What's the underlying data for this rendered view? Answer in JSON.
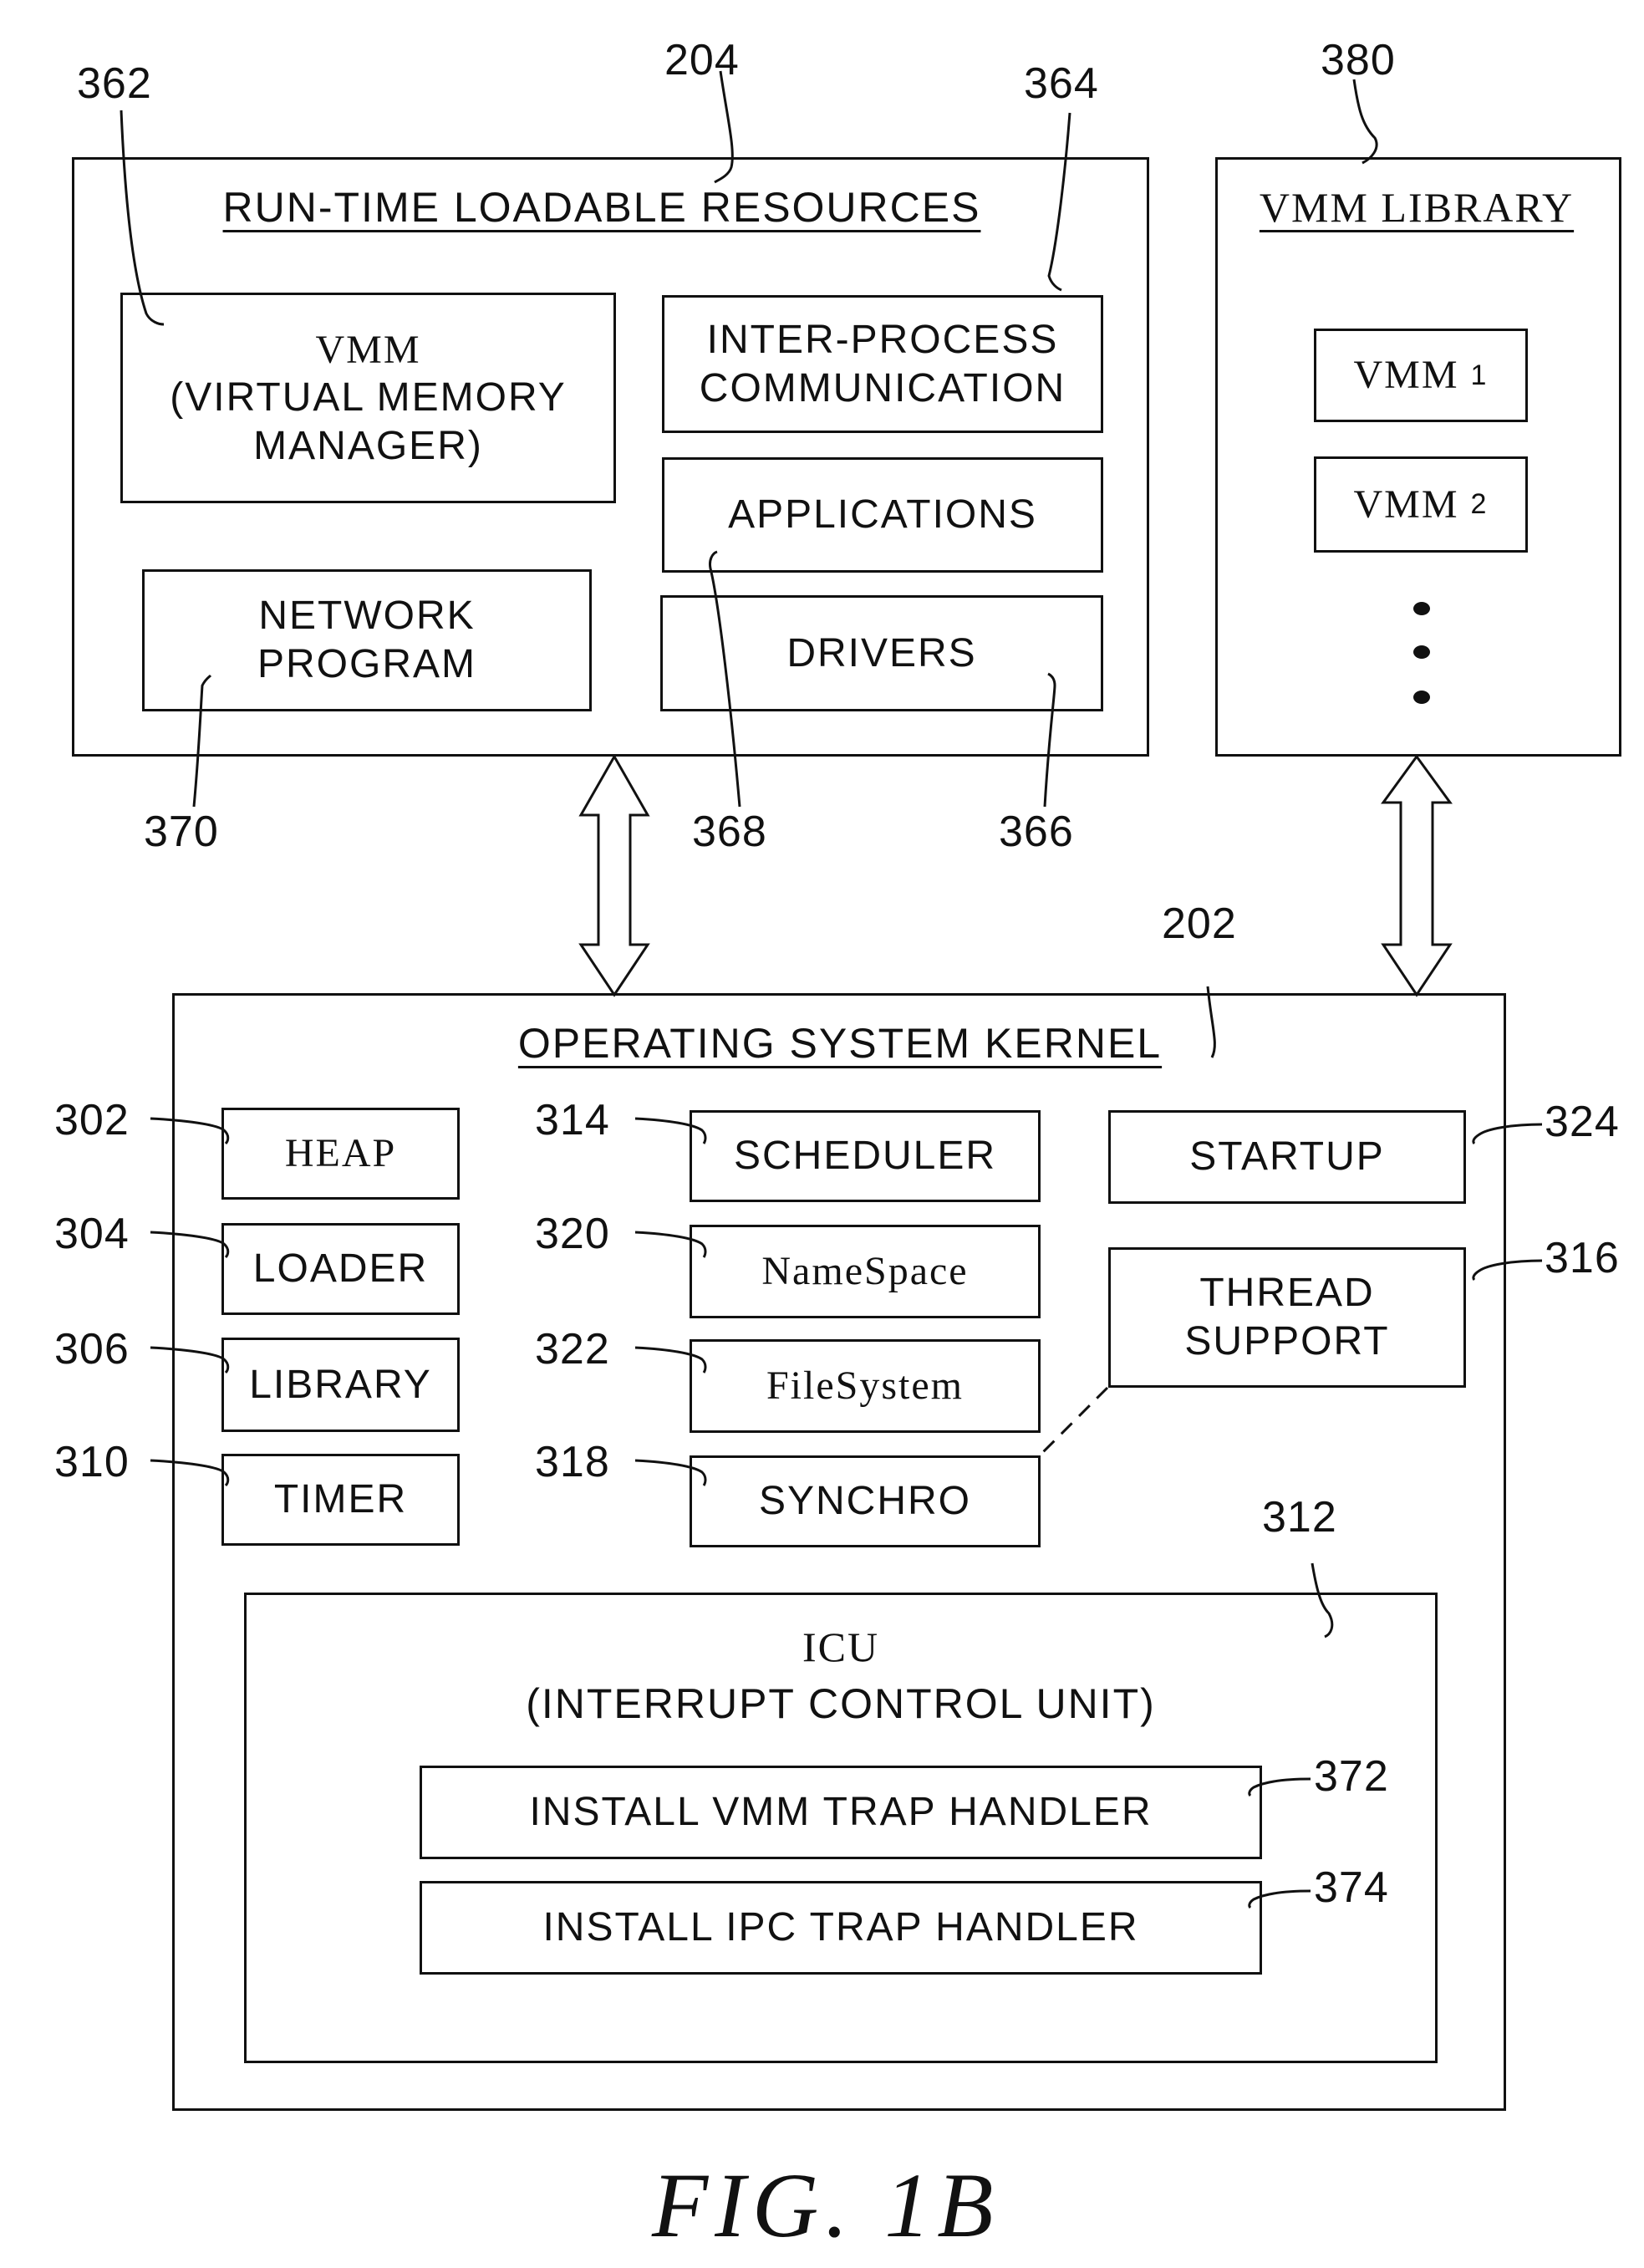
{
  "figure_label": "FIG. 1B",
  "runtime_resources": {
    "ref": "204",
    "title": "RUN-TIME LOADABLE RESOURCES",
    "items": [
      {
        "ref": "362",
        "label_line1": "VMM",
        "label_line2": "(VIRTUAL MEMORY",
        "label_line3": "MANAGER)"
      },
      {
        "ref": "364",
        "label_line1": "INTER-PROCESS",
        "label_line2": "COMMUNICATION"
      },
      {
        "ref": "368",
        "label": "APPLICATIONS"
      },
      {
        "ref": "370",
        "label_line1": "NETWORK",
        "label_line2": "PROGRAM"
      },
      {
        "ref": "366",
        "label": "DRIVERS"
      }
    ]
  },
  "vmm_library": {
    "ref": "380",
    "title": "VMM LIBRARY",
    "items": [
      {
        "name": "VMM",
        "subscript": "1"
      },
      {
        "name": "VMM",
        "subscript": "2"
      }
    ]
  },
  "kernel": {
    "ref": "202",
    "title": "OPERATING SYSTEM KERNEL",
    "items": [
      {
        "ref": "302",
        "label": "HEAP"
      },
      {
        "ref": "304",
        "label": "LOADER"
      },
      {
        "ref": "306",
        "label": "LIBRARY"
      },
      {
        "ref": "310",
        "label": "TIMER"
      },
      {
        "ref": "314",
        "label": "SCHEDULER"
      },
      {
        "ref": "320",
        "label": "NameSpace"
      },
      {
        "ref": "322",
        "label": "FileSystem"
      },
      {
        "ref": "318",
        "label": "SYNCHRO"
      },
      {
        "ref": "324",
        "label": "STARTUP"
      },
      {
        "ref": "316",
        "label_line1": "THREAD",
        "label_line2": "SUPPORT"
      }
    ],
    "icu": {
      "ref": "312",
      "title_line1": "ICU",
      "title_line2": "(INTERRUPT CONTROL UNIT)",
      "handlers": [
        {
          "ref": "372",
          "label": "INSTALL VMM TRAP HANDLER"
        },
        {
          "ref": "374",
          "label": "INSTALL IPC TRAP HANDLER"
        }
      ]
    }
  }
}
